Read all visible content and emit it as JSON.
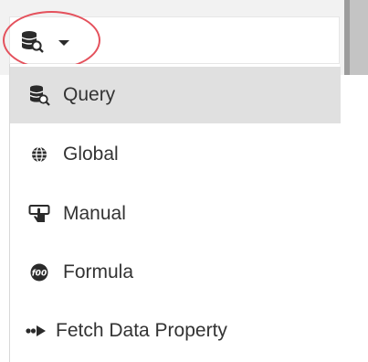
{
  "toolbar": {
    "source_icon": "database-search-icon",
    "dropdown_icon": "caret-down-icon"
  },
  "menu": {
    "items": [
      {
        "label": "Query",
        "icon": "database-search-icon",
        "selected": true
      },
      {
        "label": "Global",
        "icon": "globe-icon",
        "selected": false
      },
      {
        "label": "Manual",
        "icon": "hand-pointer-icon",
        "selected": false
      },
      {
        "label": "Formula",
        "icon": "formula-icon",
        "selected": false
      },
      {
        "label": "Fetch Data Property",
        "icon": "fetch-data-icon",
        "selected": false
      }
    ]
  },
  "colors": {
    "highlight_ring": "#e4515c",
    "selected_row": "#e0e0e0",
    "text": "#333333"
  }
}
